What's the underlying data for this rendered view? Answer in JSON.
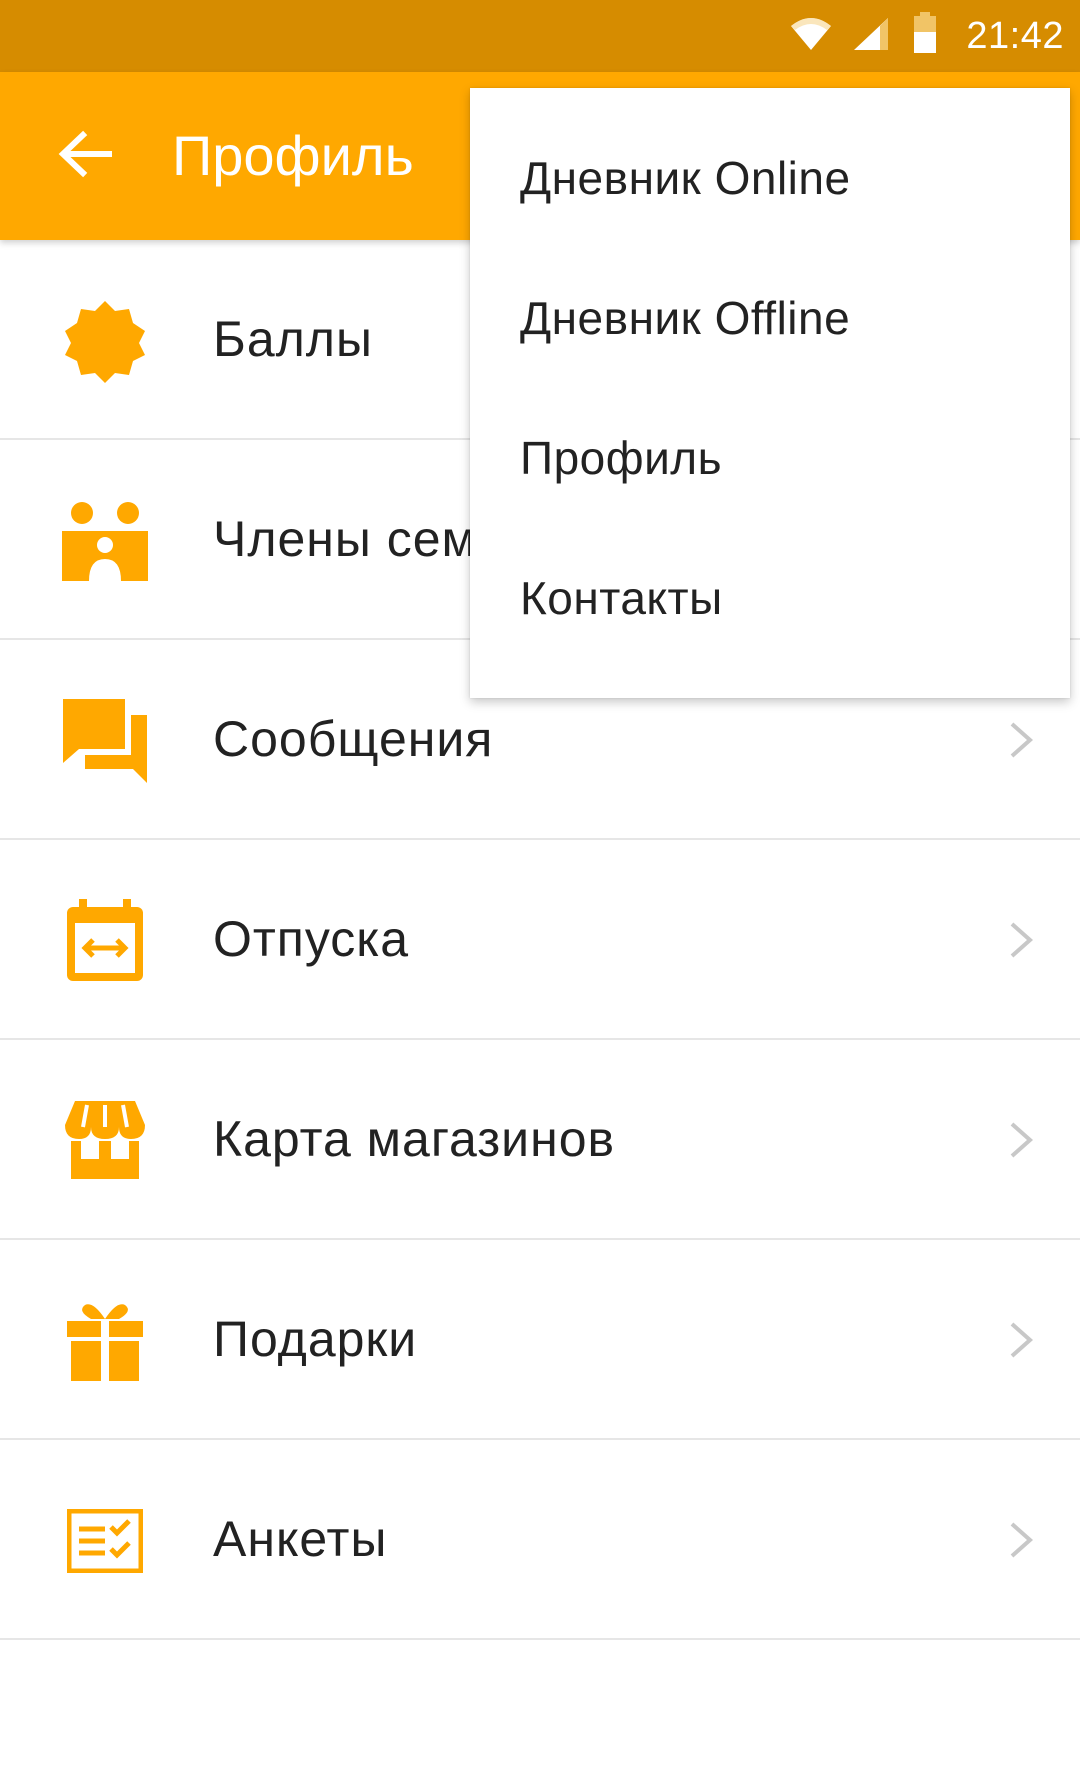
{
  "status_bar": {
    "time": "21:42",
    "icons": [
      "wifi-icon",
      "signal-icon",
      "battery-icon"
    ],
    "color": "#D68C00"
  },
  "app_bar": {
    "title": "Профиль",
    "back_icon": "arrow-back-icon",
    "color": "#FFA800"
  },
  "menu": {
    "items": [
      {
        "label": "Баллы",
        "icon": "badge-icon",
        "chevron": false
      },
      {
        "label": "Члены семьи",
        "icon": "family-icon",
        "chevron": false
      },
      {
        "label": "Сообщения",
        "icon": "chat-icon",
        "chevron": true
      },
      {
        "label": "Отпуска",
        "icon": "calendar-icon",
        "chevron": true
      },
      {
        "label": "Карта магазинов",
        "icon": "store-icon",
        "chevron": true
      },
      {
        "label": "Подарки",
        "icon": "gift-icon",
        "chevron": true
      },
      {
        "label": "Анкеты",
        "icon": "checklist-icon",
        "chevron": true
      }
    ],
    "icon_color": "#FFA800",
    "chevron_color": "#C8C8C8"
  },
  "overflow_menu": {
    "items": [
      {
        "label": "Дневник Online"
      },
      {
        "label": "Дневник Offline"
      },
      {
        "label": "Профиль"
      },
      {
        "label": "Контакты"
      }
    ]
  }
}
